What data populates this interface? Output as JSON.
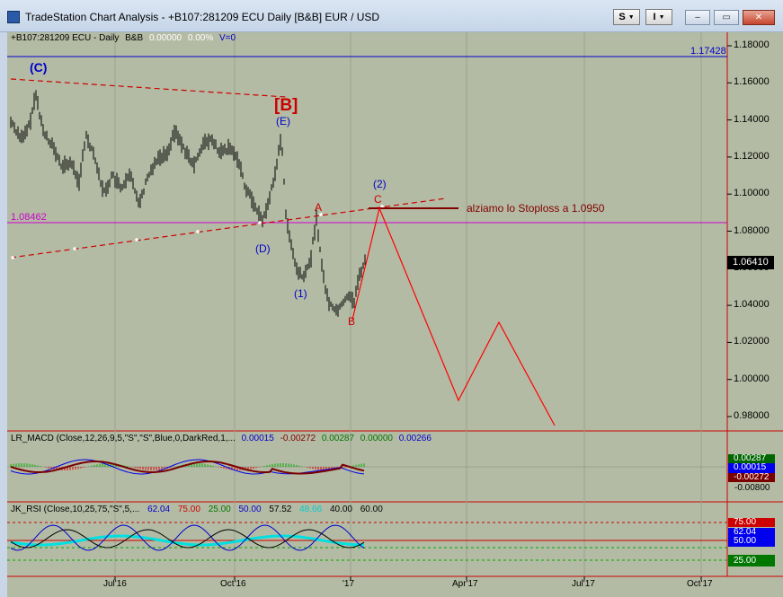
{
  "window": {
    "title": "TradeStation Chart Analysis - +B107:281209 ECU Daily [B&B] EUR / USD",
    "symbol_btn": "S",
    "insert_btn": "I",
    "minimize": "–",
    "restore": "▭",
    "close": "✕"
  },
  "colors": {
    "background": "#b4bba4",
    "price_bars": "#000000",
    "wave_labels": "#0000cc",
    "red_labels": "#cc0000",
    "resistance_line": "#0000cc",
    "horizontal_line": "#cc00cc",
    "stoploss_line": "#800000",
    "projection": "#ff0000"
  },
  "header": {
    "symbol": "+B107:281209 ECU - Daily",
    "bb": "B&B",
    "price": "0.00000",
    "pct": "0.00%",
    "volume": "V=0"
  },
  "main": {
    "price_ticks": [
      "1.18000",
      "1.16000",
      "1.14000",
      "1.12000",
      "1.10000",
      "1.08000",
      "1.06000",
      "1.04000",
      "1.02000",
      "1.00000",
      "0.98000"
    ],
    "resistance_value": "1.17428",
    "horizontal_value": "1.08462",
    "last_price": "1.06410",
    "labels": {
      "c_top": "(C)",
      "b_big": "[B]",
      "e": "(E)",
      "d": "(D)",
      "a": "A",
      "one": "(1)",
      "b_small": "B",
      "two": "(2)",
      "c_small": "C"
    },
    "annotation": "alziamo lo Stoploss a 1.0950"
  },
  "macd": {
    "name": "LR_MACD (Close,12,26,9,5,\"S\",\"S\",Blue,0,DarkRed,1,...",
    "v1": "0.00015",
    "v2": "-0.00272",
    "v3": "0.00287",
    "v4": "0.00000",
    "v5": "0.00266",
    "axis_tags": [
      "0.00287",
      "0.00015",
      "-0.00272"
    ],
    "tick_low": "-0.00800"
  },
  "rsi": {
    "name": "JK_RSI (Close,10,25,75,\"S\",5,...",
    "v1": "62.04",
    "v2": "75.00",
    "v3": "25.00",
    "v4": "50.00",
    "v5": "57.52",
    "v6": "48.66",
    "v7": "40.00",
    "v8": "60.00",
    "axis_tags": [
      "75.00",
      "62.04",
      "50.00",
      "25.00"
    ]
  },
  "time_axis": [
    "Jul'16",
    "Oct'16",
    "'17",
    "Apr'17",
    "Jul'17",
    "Oct'17"
  ]
}
